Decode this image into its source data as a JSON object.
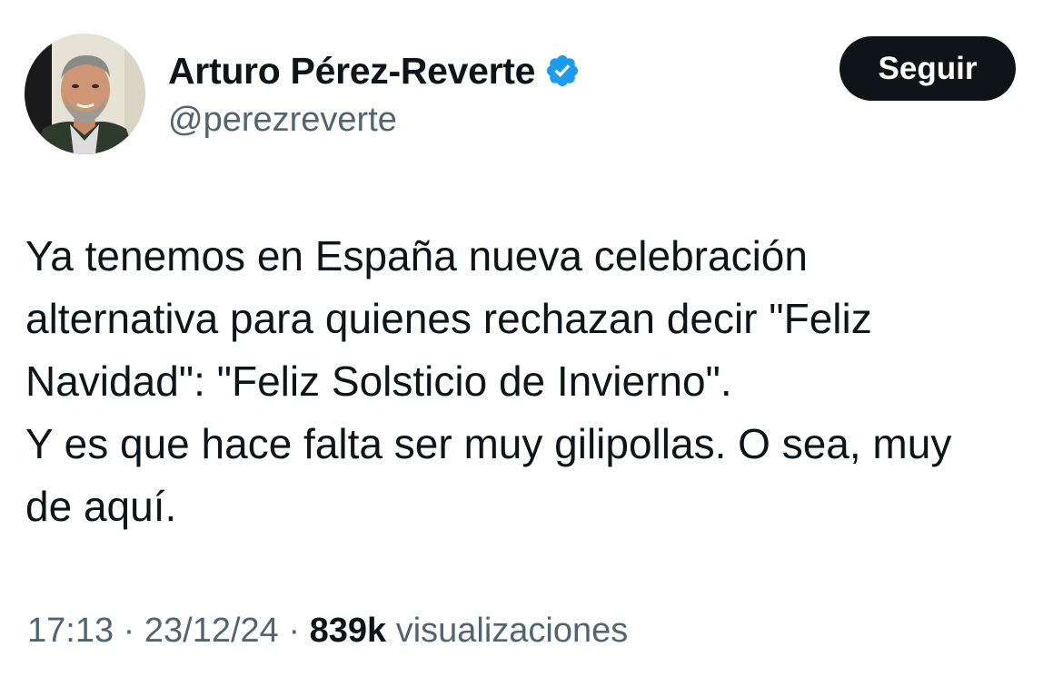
{
  "author": {
    "display_name": "Arturo Pérez-Reverte",
    "handle": "@perezreverte",
    "verified_icon": "verified-badge-icon",
    "verified_color": "#1d9bf0"
  },
  "follow_button": {
    "label": "Seguir"
  },
  "tweet": {
    "lines": [
      "Ya tenemos en España nueva celebración",
      "alternativa para quienes rechazan decir \"Feliz",
      "Navidad\": \"Feliz Solsticio de Invierno\".",
      "Y es que hace falta ser muy gilipollas. O sea, muy",
      "de aquí."
    ]
  },
  "meta": {
    "time": "17:13",
    "separator": "·",
    "date": "23/12/24",
    "views_count": "839k",
    "views_label": "visualizaciones"
  },
  "colors": {
    "text_primary": "#0f1419",
    "text_secondary": "#536471",
    "button_bg": "#0f1419",
    "button_text": "#ffffff"
  }
}
